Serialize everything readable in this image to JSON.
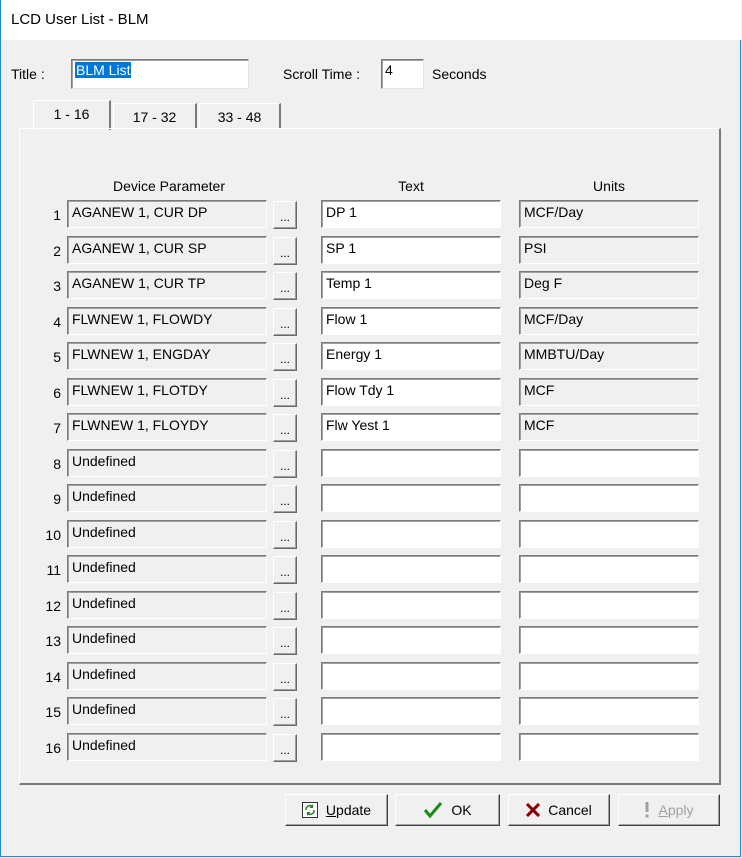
{
  "window": {
    "title": "LCD User List - BLM"
  },
  "header": {
    "title_label": "Title :",
    "title_value": "BLM List",
    "scroll_label": "Scroll Time :",
    "scroll_value": "4",
    "seconds_label": "Seconds"
  },
  "tabs": [
    {
      "label": "1 - 16",
      "active": true
    },
    {
      "label": "17 - 32",
      "active": false
    },
    {
      "label": "33 - 48",
      "active": false
    }
  ],
  "columns": {
    "device": "Device Parameter",
    "text": "Text",
    "units": "Units"
  },
  "browse_label": "...",
  "rows": [
    {
      "num": "1",
      "device": "AGANEW 1, CUR DP",
      "text": "DP 1",
      "units": "MCF/Day"
    },
    {
      "num": "2",
      "device": "AGANEW 1, CUR SP",
      "text": "SP 1",
      "units": "PSI"
    },
    {
      "num": "3",
      "device": "AGANEW 1, CUR TP",
      "text": "Temp 1",
      "units": "Deg F"
    },
    {
      "num": "4",
      "device": "FLWNEW 1, FLOWDY",
      "text": "Flow 1",
      "units": "MCF/Day"
    },
    {
      "num": "5",
      "device": "FLWNEW 1, ENGDAY",
      "text": "Energy 1",
      "units": "MMBTU/Day"
    },
    {
      "num": "6",
      "device": "FLWNEW 1, FLOTDY",
      "text": "Flow Tdy 1",
      "units": "MCF"
    },
    {
      "num": "7",
      "device": "FLWNEW 1, FLOYDY",
      "text": "Flw Yest 1",
      "units": "MCF"
    },
    {
      "num": "8",
      "device": "Undefined",
      "text": "",
      "units": ""
    },
    {
      "num": "9",
      "device": "Undefined",
      "text": "",
      "units": ""
    },
    {
      "num": "10",
      "device": "Undefined",
      "text": "",
      "units": ""
    },
    {
      "num": "11",
      "device": "Undefined",
      "text": "",
      "units": ""
    },
    {
      "num": "12",
      "device": "Undefined",
      "text": "",
      "units": ""
    },
    {
      "num": "13",
      "device": "Undefined",
      "text": "",
      "units": ""
    },
    {
      "num": "14",
      "device": "Undefined",
      "text": "",
      "units": ""
    },
    {
      "num": "15",
      "device": "Undefined",
      "text": "",
      "units": ""
    },
    {
      "num": "16",
      "device": "Undefined",
      "text": "",
      "units": ""
    }
  ],
  "buttons": {
    "update": "Update",
    "ok": "OK",
    "cancel": "Cancel",
    "apply": "Apply"
  },
  "colors": {
    "ok_check": "#1a8a1a",
    "cancel_x": "#8b0000",
    "update_icon": "#2e7d32",
    "selection": "#0078d7"
  }
}
